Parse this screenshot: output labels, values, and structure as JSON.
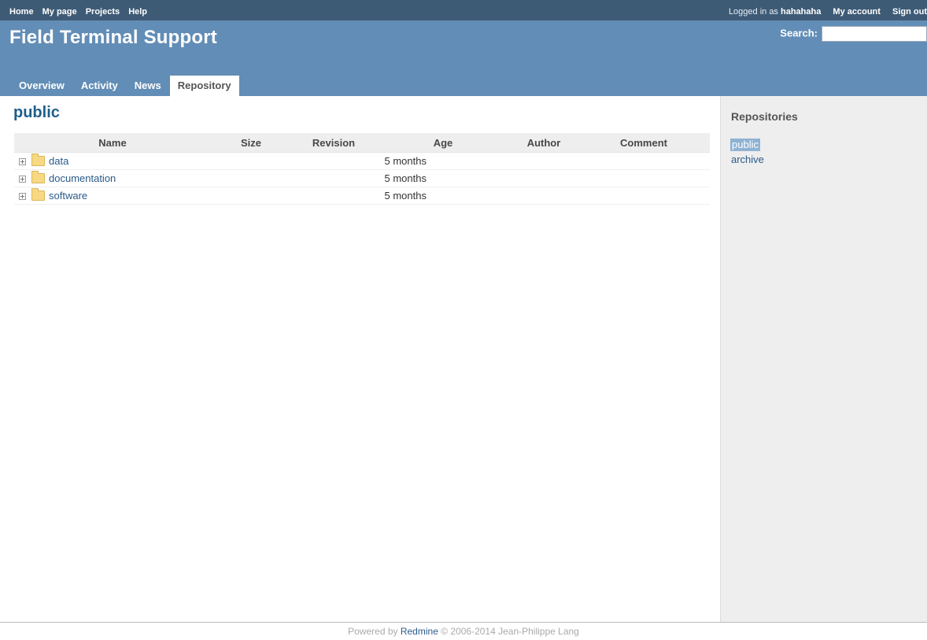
{
  "top_menu": {
    "left_links": [
      "Home",
      "My page",
      "Projects",
      "Help"
    ],
    "logged_in_label": "Logged in as",
    "username": "hahahaha",
    "my_account": "My account",
    "sign_out": "Sign out"
  },
  "header": {
    "title": "Field Terminal Support",
    "search_label": "Search:",
    "search_value": ""
  },
  "main_menu": {
    "tabs": [
      "Overview",
      "Activity",
      "News",
      "Repository"
    ],
    "selected": "Repository"
  },
  "content": {
    "heading": "public",
    "table": {
      "columns": [
        "Name",
        "Size",
        "Revision",
        "Age",
        "Author",
        "Comment"
      ],
      "rows": [
        {
          "name": "data",
          "size": "",
          "revision": "",
          "age": "5 months",
          "author": "",
          "comment": ""
        },
        {
          "name": "documentation",
          "size": "",
          "revision": "",
          "age": "5 months",
          "author": "",
          "comment": ""
        },
        {
          "name": "software",
          "size": "",
          "revision": "",
          "age": "5 months",
          "author": "",
          "comment": ""
        }
      ]
    }
  },
  "sidebar": {
    "heading": "Repositories",
    "repositories": [
      "public",
      "archive"
    ],
    "selected": "public"
  },
  "footer": {
    "prefix": "Powered by",
    "link": "Redmine",
    "suffix": "© 2006-2014 Jean-Philippe Lang"
  },
  "colors": {
    "top_menu_bg": "#3e5b76",
    "header_bg": "#628db6",
    "link": "#2a5a8a",
    "heading": "#1f5f8b",
    "sidebar_bg": "#eeeeee"
  }
}
